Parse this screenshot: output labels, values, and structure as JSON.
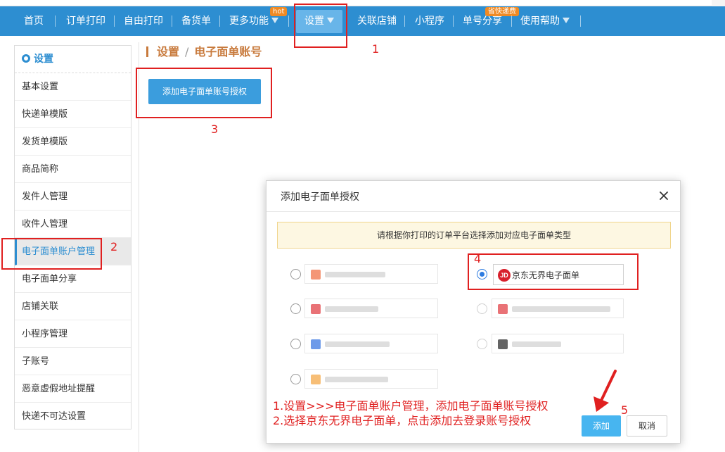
{
  "nav": {
    "items": [
      {
        "label": "首页"
      },
      {
        "label": "订单打印"
      },
      {
        "label": "自由打印"
      },
      {
        "label": "备货单"
      },
      {
        "label": "更多功能"
      },
      {
        "label": "设置"
      },
      {
        "label": "关联店铺"
      },
      {
        "label": "小程序"
      },
      {
        "label": "单号分享"
      },
      {
        "label": "使用帮助"
      }
    ],
    "badges": {
      "hot": "hot",
      "sf": "省快递费"
    }
  },
  "sidebar": {
    "title": "设置",
    "items": [
      {
        "label": "基本设置"
      },
      {
        "label": "快递单模版"
      },
      {
        "label": "发货单模版"
      },
      {
        "label": "商品简称"
      },
      {
        "label": "发件人管理"
      },
      {
        "label": "收件人管理"
      },
      {
        "label": "电子面单账户管理"
      },
      {
        "label": "电子面单分享"
      },
      {
        "label": "店铺关联"
      },
      {
        "label": "小程序管理"
      },
      {
        "label": "子账号"
      },
      {
        "label": "恶意虚假地址提醒"
      },
      {
        "label": "快递不可达设置"
      }
    ]
  },
  "main": {
    "breadcrumb_root": "设置",
    "breadcrumb_sep": "/",
    "breadcrumb_current": "电子面单账号",
    "add_auth_button": "添加电子面单账号授权"
  },
  "modal": {
    "title": "添加电子面单授权",
    "notice": "请根据你打印的订单平台选择添加对应电子面单类型",
    "jd_logo": "JD",
    "jd_option": "京东无界电子面单",
    "add_button": "添加",
    "cancel_button": "取消"
  },
  "annotations": {
    "n1": "1",
    "n2": "2",
    "n3": "3",
    "n4": "4",
    "n5": "5",
    "line1": "1.设置>>>电子面单账户管理，添加电子面单账号授权",
    "line2": "2.选择京东无界电子面单，点击添加去登录账号授权"
  },
  "colors": {
    "nav_bg": "#2d8ed1",
    "accent_orange": "#c87a3c",
    "annotation_red": "#e02020",
    "button_blue": "#3b9ddd"
  }
}
